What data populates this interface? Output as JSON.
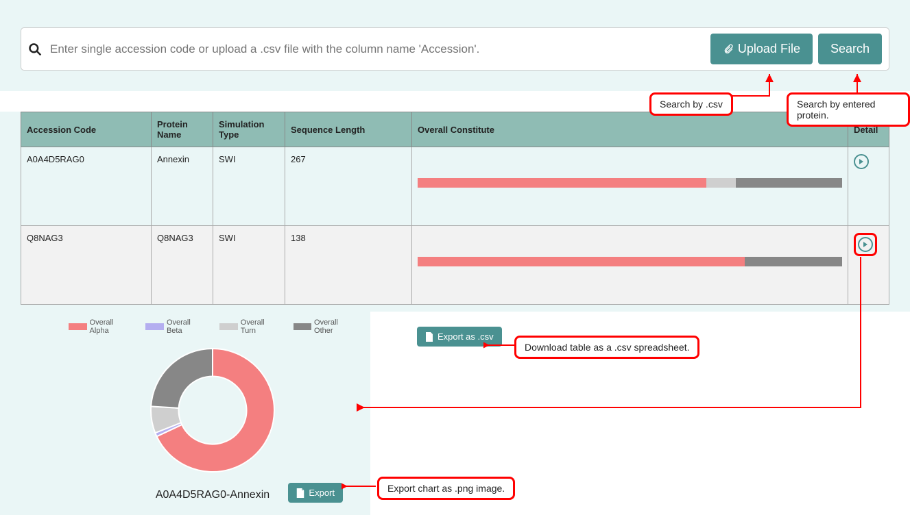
{
  "search": {
    "placeholder": "Enter single accession code or upload a .csv file with the column name 'Accession'.",
    "upload_label": "Upload File",
    "search_label": "Search"
  },
  "callouts": {
    "search_csv": "Search by .csv",
    "search_protein": "Search by entered protein.",
    "download_table": "Download table as a .csv spreadsheet.",
    "export_chart": "Export chart as .png image."
  },
  "table": {
    "headers": {
      "accession": "Accession Code",
      "protein": "Protein Name",
      "simulation": "Simulation Type",
      "seqlen": "Sequence Length",
      "constitute": "Overall Constitute",
      "detail": "Detail"
    },
    "rows": [
      {
        "accession": "A0A4D5RAG0",
        "protein": "Annexin",
        "simulation": "SWI",
        "seqlen": "267",
        "bar": {
          "alpha": 68,
          "beta": 0,
          "turn": 7,
          "other": 25
        }
      },
      {
        "accession": "Q8NAG3",
        "protein": "Q8NAG3",
        "simulation": "SWI",
        "seqlen": "138",
        "bar": {
          "alpha": 77,
          "beta": 0,
          "turn": 0,
          "other": 23
        }
      }
    ]
  },
  "export": {
    "csv_label": "Export as .csv",
    "chart_label": "Export"
  },
  "legend": {
    "alpha": "Overall Alpha",
    "beta": "Overall Beta",
    "turn": "Overall Turn",
    "other": "Overall Other"
  },
  "chart_title": "A0A4D5RAG0-Annexin",
  "colors": {
    "alpha": "#f47f80",
    "beta": "#b4aef0",
    "turn": "#cfcfcf",
    "other": "#878787"
  },
  "chart_data": {
    "type": "pie",
    "title": "A0A4D5RAG0-Annexin",
    "series": [
      {
        "name": "Overall Alpha",
        "value": 68,
        "color": "#f47f80"
      },
      {
        "name": "Overall Beta",
        "value": 1,
        "color": "#b4aef0"
      },
      {
        "name": "Overall Turn",
        "value": 7,
        "color": "#cfcfcf"
      },
      {
        "name": "Overall Other",
        "value": 24,
        "color": "#878787"
      }
    ],
    "inner_radius_ratio": 0.55
  }
}
